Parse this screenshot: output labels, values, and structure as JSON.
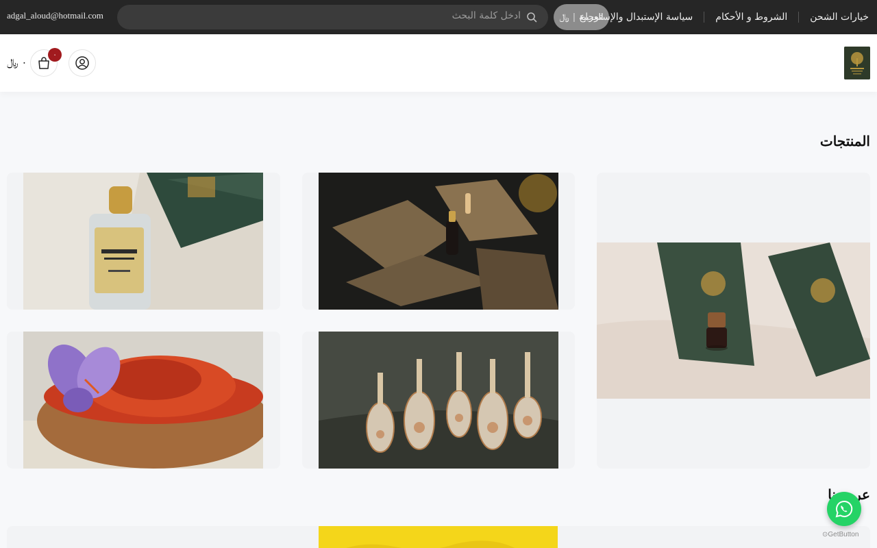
{
  "topbar": {
    "email": "adgal_aloud@hotmail.com",
    "search_placeholder": "ادخل كلمة البحث",
    "language": "العربية",
    "currency": "﷼",
    "links": [
      "خيارات الشحن",
      "الشروط و الأحكام",
      "سياسة الإستبدال والإسترجاع"
    ]
  },
  "header": {
    "cart_count": "٠",
    "cart_total": "٠ ﷼"
  },
  "sections": {
    "products_title": "المنتجات",
    "offers_title": "عروضنا"
  },
  "whatsapp": {
    "label": "GetButton"
  },
  "colors": {
    "topbar": "#262626",
    "badge": "#a11a1e",
    "whatsapp": "#25d366"
  }
}
